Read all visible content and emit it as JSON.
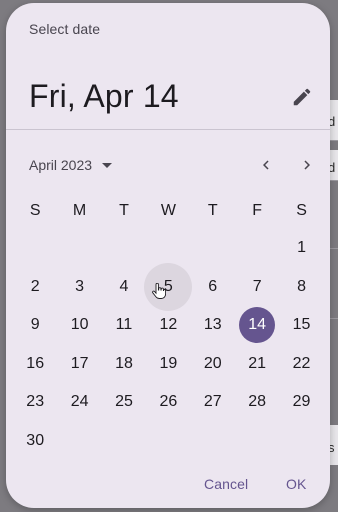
{
  "background": {
    "right_text": [
      "d",
      "d",
      "s"
    ]
  },
  "dialog": {
    "headline_label": "Select date",
    "selected_date": "Fri, Apr 14",
    "month_year": "April 2023",
    "weekdays": [
      "S",
      "M",
      "T",
      "W",
      "T",
      "F",
      "S"
    ],
    "weeks": [
      [
        "",
        "",
        "",
        "",
        "",
        "",
        "1"
      ],
      [
        "2",
        "3",
        "4",
        "5",
        "6",
        "7",
        "8"
      ],
      [
        "9",
        "10",
        "11",
        "12",
        "13",
        "14",
        "15"
      ],
      [
        "16",
        "17",
        "18",
        "19",
        "20",
        "21",
        "22"
      ],
      [
        "23",
        "24",
        "25",
        "26",
        "27",
        "28",
        "29"
      ],
      [
        "30",
        "",
        "",
        "",
        "",
        "",
        ""
      ]
    ],
    "selected_day": "14",
    "hover_day": "5",
    "cancel_label": "Cancel",
    "ok_label": "OK",
    "icons": {
      "edit": "pencil-icon",
      "prev": "chevron-left-icon",
      "next": "chevron-right-icon",
      "dropdown": "caret-down-icon",
      "cursor": "hand-pointer-icon"
    },
    "colors": {
      "surface": "#ece6f0",
      "primary": "#65558f",
      "on_surface": "#1d1b20",
      "hover": "#dcd6df"
    }
  }
}
